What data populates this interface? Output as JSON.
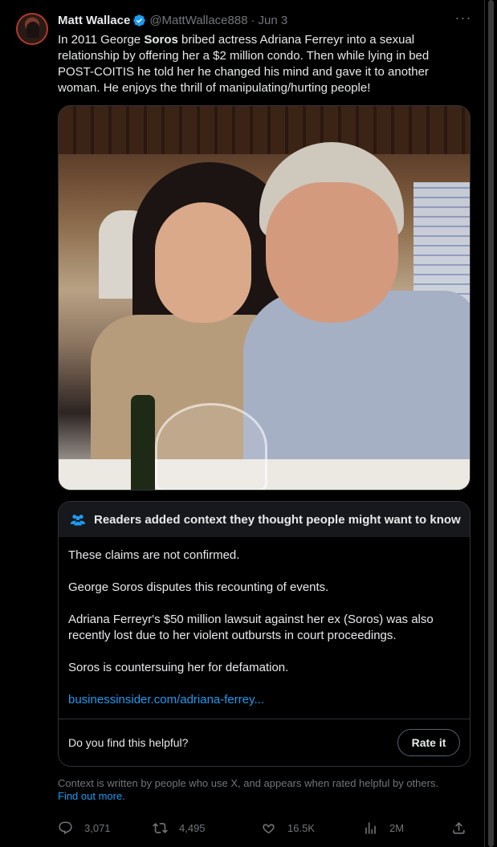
{
  "tweet": {
    "author_name": "Matt Wallace",
    "handle": "@MattWallace888",
    "separator": "·",
    "date": "Jun 3",
    "more": "···",
    "text_before": "In 2011 George ",
    "text_bold": "Soros",
    "text_after": " bribed actress Adriana Ferreyr into a sexual relationship by offering her a $2 million condo. Then while lying in bed POST-COITIS he told her he changed his mind and gave it to another woman. He enjoys the thrill of manipulating/hurting people!"
  },
  "community_note": {
    "header": "Readers added context they thought people might want to know",
    "paragraphs": [
      "These claims are not confirmed.",
      "George Soros disputes this recounting of events.",
      "Adriana Ferreyr's $50 million lawsuit against her ex (Soros) was also recently lost due to her violent outbursts in court proceedings.",
      "Soros is countersuing her for defamation."
    ],
    "link": "businessinsider.com/adriana-ferrey...",
    "helpful_question": "Do you find this helpful?",
    "rate_label": "Rate it"
  },
  "context": {
    "text": "Context is written by people who use X, and appears when rated helpful by others.",
    "link": "Find out more."
  },
  "actions": {
    "replies": "3,071",
    "reposts": "4,495",
    "likes": "16.5K",
    "views": "2M"
  },
  "colors": {
    "background": "#000000",
    "text": "#e7e9ea",
    "muted": "#71767b",
    "link": "#1d9bf0",
    "verified": "#1d9bf0",
    "border": "#2f3336"
  }
}
